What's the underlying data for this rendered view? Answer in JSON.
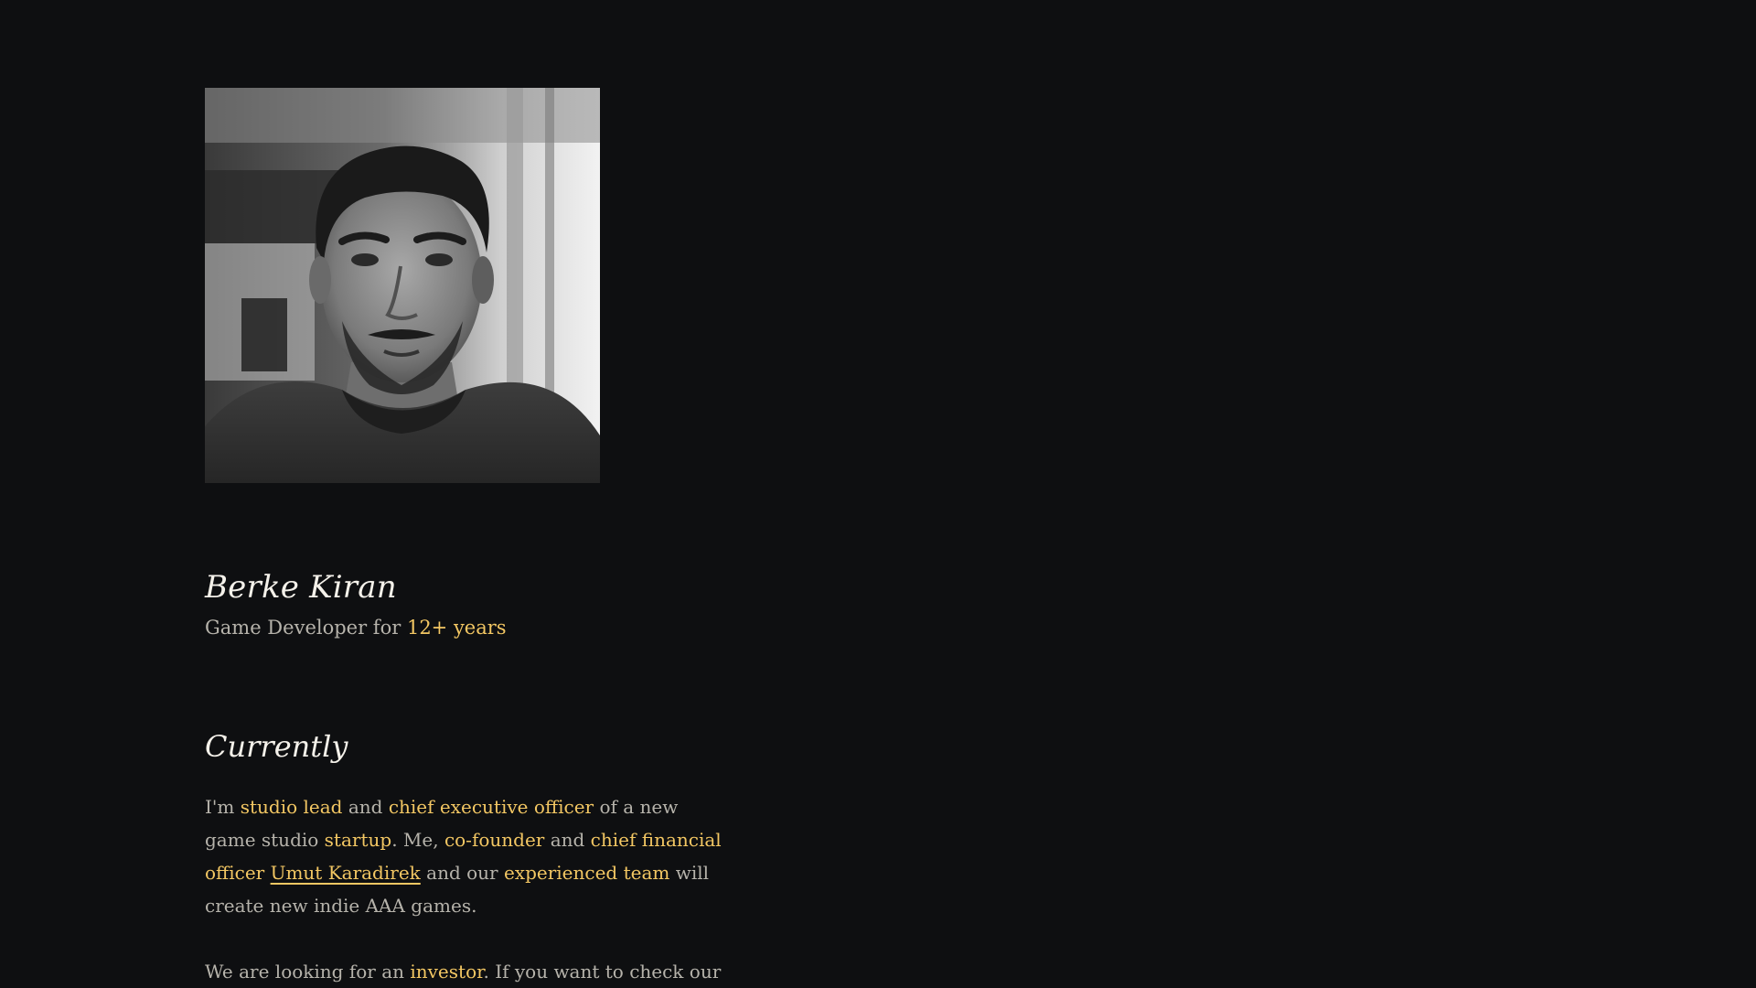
{
  "profile": {
    "name": "Berke Kiran",
    "tagline_prefix": "Game Developer for ",
    "tagline_highlight": "12+ years",
    "photo_icon": "portrait-photo"
  },
  "currently": {
    "title": "Currently",
    "paragraph1": {
      "t1": "I'm ",
      "h1": "studio lead",
      "t2": " and ",
      "h2": "chief executive officer",
      "t3": " of a new game studio ",
      "h3": "startup",
      "t4": ". Me, ",
      "h4": "co-founder",
      "t5": " and ",
      "h5": "chief financial officer",
      "t6": " ",
      "link1": "Umut Karadirek",
      "t7": " and our ",
      "h6": "experienced team",
      "t8": " will create new indie AAA games."
    },
    "paragraph2": {
      "t1": "We are looking for an ",
      "h1": "investor",
      "t2": ". If you want to check our"
    }
  },
  "colors": {
    "background": "#0e0f11",
    "text": "#b6b3ab",
    "heading": "#f4f1ea",
    "accent": "#f3c763"
  }
}
